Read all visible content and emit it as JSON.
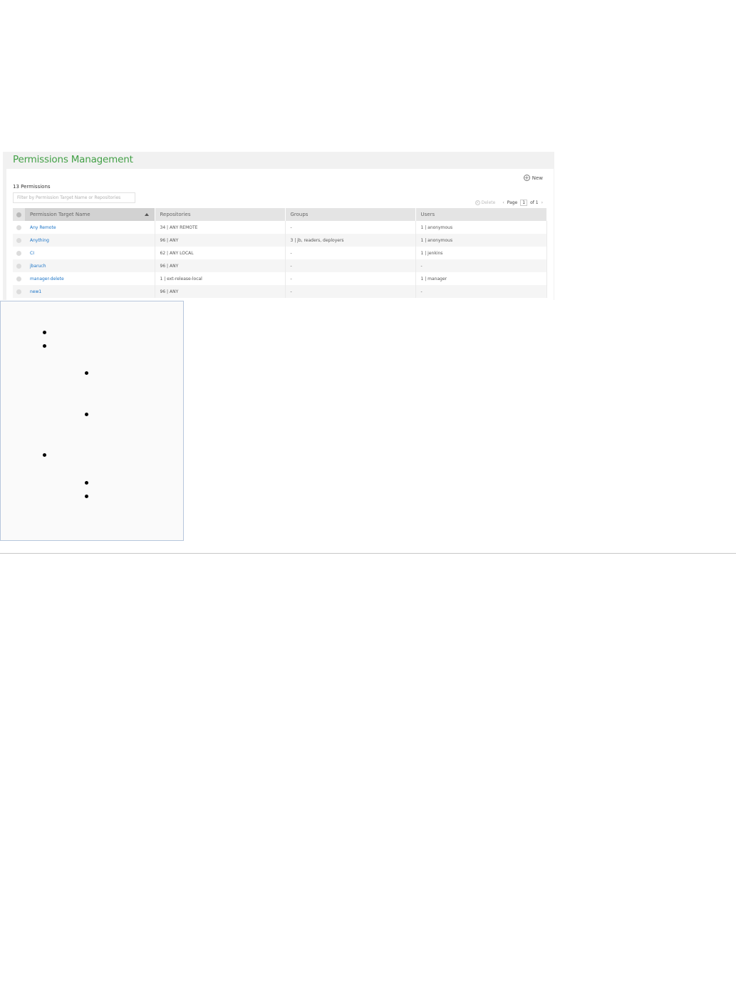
{
  "panel": {
    "title": "Permissions Management",
    "new_label": "New",
    "count_label": "13 Permissions",
    "filter_placeholder": "Filter by Permission Target Name or Repositories",
    "delete_label": "Delete",
    "page_label": "Page",
    "page_current": "1",
    "page_total": "of 1"
  },
  "table": {
    "columns": [
      "Permission Target Name",
      "Repositories",
      "Groups",
      "Users"
    ],
    "rows": [
      {
        "name": "Any Remote",
        "repositories": "34 | ANY REMOTE",
        "groups": "-",
        "users": "1 | anonymous"
      },
      {
        "name": "Anything",
        "repositories": "96 | ANY",
        "groups": "3 | jb, readers, deployers",
        "users": "1 | anonymous"
      },
      {
        "name": "CI",
        "repositories": "62 | ANY LOCAL",
        "groups": "-",
        "users": "1 | jenkins"
      },
      {
        "name": "jbaruch",
        "repositories": "96 | ANY",
        "groups": "-",
        "users": "-"
      },
      {
        "name": "manager-delete",
        "repositories": "1 | ext-release-local",
        "groups": "-",
        "users": "1 | manager"
      },
      {
        "name": "new1",
        "repositories": "96 | ANY",
        "groups": "-",
        "users": "-"
      }
    ]
  },
  "icons": {
    "new": "plus-circle-icon",
    "delete": "x-circle-icon",
    "sort": "sort-ascending-icon"
  },
  "colors": {
    "title_green": "#43a047",
    "link_blue": "#1a73c7",
    "box_border": "#b6c6dc"
  }
}
